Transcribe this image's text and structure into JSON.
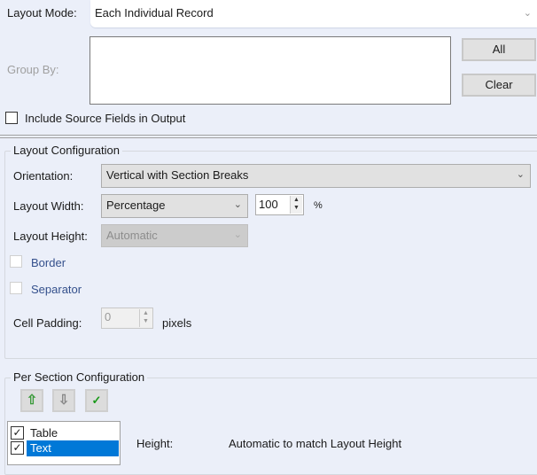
{
  "top": {
    "layout_mode_label": "Layout Mode:",
    "layout_mode_value": "Each Individual Record",
    "group_by_label": "Group By:",
    "all_button": "All",
    "clear_button": "Clear",
    "include_source_label": "Include Source Fields in Output",
    "include_source_checked": false
  },
  "layout_config": {
    "legend": "Layout Configuration",
    "orientation_label": "Orientation:",
    "orientation_value": "Vertical with Section Breaks",
    "width_label": "Layout Width:",
    "width_mode": "Percentage",
    "width_value": "100",
    "width_unit": "%",
    "height_label": "Layout Height:",
    "height_value": "Automatic",
    "border_label": "Border",
    "separator_label": "Separator",
    "cell_padding_label": "Cell Padding:",
    "cell_padding_value": "0",
    "cell_padding_unit": "pixels"
  },
  "section_config": {
    "legend": "Per Section Configuration",
    "sections": [
      {
        "label": "Table",
        "checked": true
      },
      {
        "label": "Text",
        "checked": true,
        "selected": true
      }
    ],
    "height_label": "Height:",
    "height_value": "Automatic to match Layout Height"
  },
  "colors": {
    "accent": "#0078d7",
    "link_label": "#34508c"
  }
}
